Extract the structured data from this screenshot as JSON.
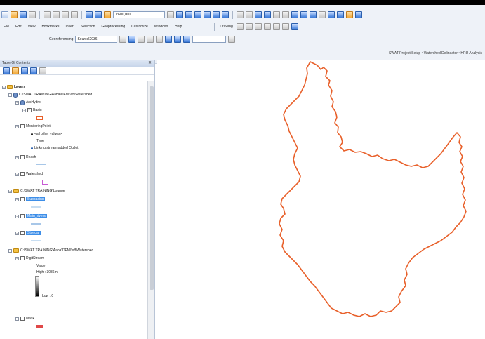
{
  "toolbar": {
    "scale": "1:600,000",
    "menus": [
      "File",
      "Edit",
      "View",
      "Bookmarks",
      "Insert",
      "Selection",
      "Geoprocessing",
      "Customize",
      "Windows",
      "Help"
    ],
    "drawing": "Drawing",
    "georef_label": "Georeferencing",
    "georef_layer": "Sourcel2036",
    "swat_menu": "SWAT Project Setup •  Watershed Delineator •  HRU Analysis"
  },
  "toc": {
    "title": "Table Of Contents",
    "pin": "✕",
    "layers_label": "Layers",
    "items": [
      {
        "label": "C:\\SWAT TRAINING\\Aaba\\DEM\\\\xff\\Watershed"
      },
      {
        "label": "ArcHydro"
      },
      {
        "label": "Basin"
      },
      {
        "label": "MonitoringPoint"
      },
      {
        "label": "<all other values>"
      },
      {
        "label": "Type"
      },
      {
        "label": "Linking stream added Outlet"
      },
      {
        "label": "Reach"
      },
      {
        "label": "Watershed"
      },
      {
        "label": "C:\\SWAT TRAINING\\Lounge"
      },
      {
        "label": "Subbasins"
      },
      {
        "label": "Main_rivers"
      },
      {
        "label": "Stongal"
      },
      {
        "label": "C:\\SWAT TRAINING\\Aaba\\DEM\\\\xff\\Watershed"
      },
      {
        "label": "DigitStream"
      },
      {
        "label": "Value"
      },
      {
        "label": "High : 3086m"
      },
      {
        "label": "Low : 0"
      },
      {
        "label": "Mask"
      }
    ]
  },
  "map": {
    "outline_color": "#e8602a"
  }
}
